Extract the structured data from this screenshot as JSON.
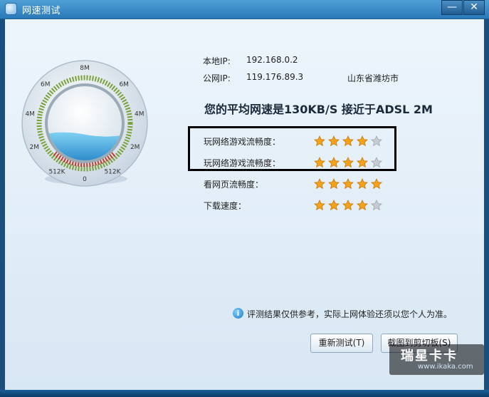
{
  "window": {
    "title": "网速测试",
    "minimize_glyph": "—",
    "close_glyph": "✕"
  },
  "gauge": {
    "marks_left": [
      "6M",
      "4M",
      "2M",
      "512K"
    ],
    "marks_right": [
      "6M",
      "4M",
      "2M",
      "512K"
    ],
    "mark_top": "8M",
    "mark_bottom": "0",
    "water_level": 0.35
  },
  "network": {
    "local_ip_label": "本地IP:",
    "local_ip": "192.168.0.2",
    "public_ip_label": "公网IP:",
    "public_ip": "119.176.89.3",
    "location": "山东省潍坊市"
  },
  "result": {
    "headline": "您的平均网速是130KB/S 接近于ADSL 2M"
  },
  "ratings": [
    {
      "label": "玩网络游戏流畅度：",
      "stars": 4,
      "max": 5
    },
    {
      "label": "玩网络游戏流畅度：",
      "stars": 4,
      "max": 5
    },
    {
      "label": "看网页流畅度：",
      "stars": 5,
      "max": 5
    },
    {
      "label": "下载速度：",
      "stars": 4,
      "max": 5
    }
  ],
  "notice": {
    "icon": "info-icon",
    "text": "评测结果仅供参考，实际上网体验还须以您个人为准。"
  },
  "buttons": {
    "retest": "重新测试(T)",
    "capture": "截图到剪切板(S)"
  },
  "watermark": {
    "main": "瑞星卡卡",
    "sub": "www.ikaka.com"
  },
  "colors": {
    "star_on": "#f5a21a",
    "star_off": "#c7ccd2",
    "title_bar": "#3a8ac7"
  }
}
